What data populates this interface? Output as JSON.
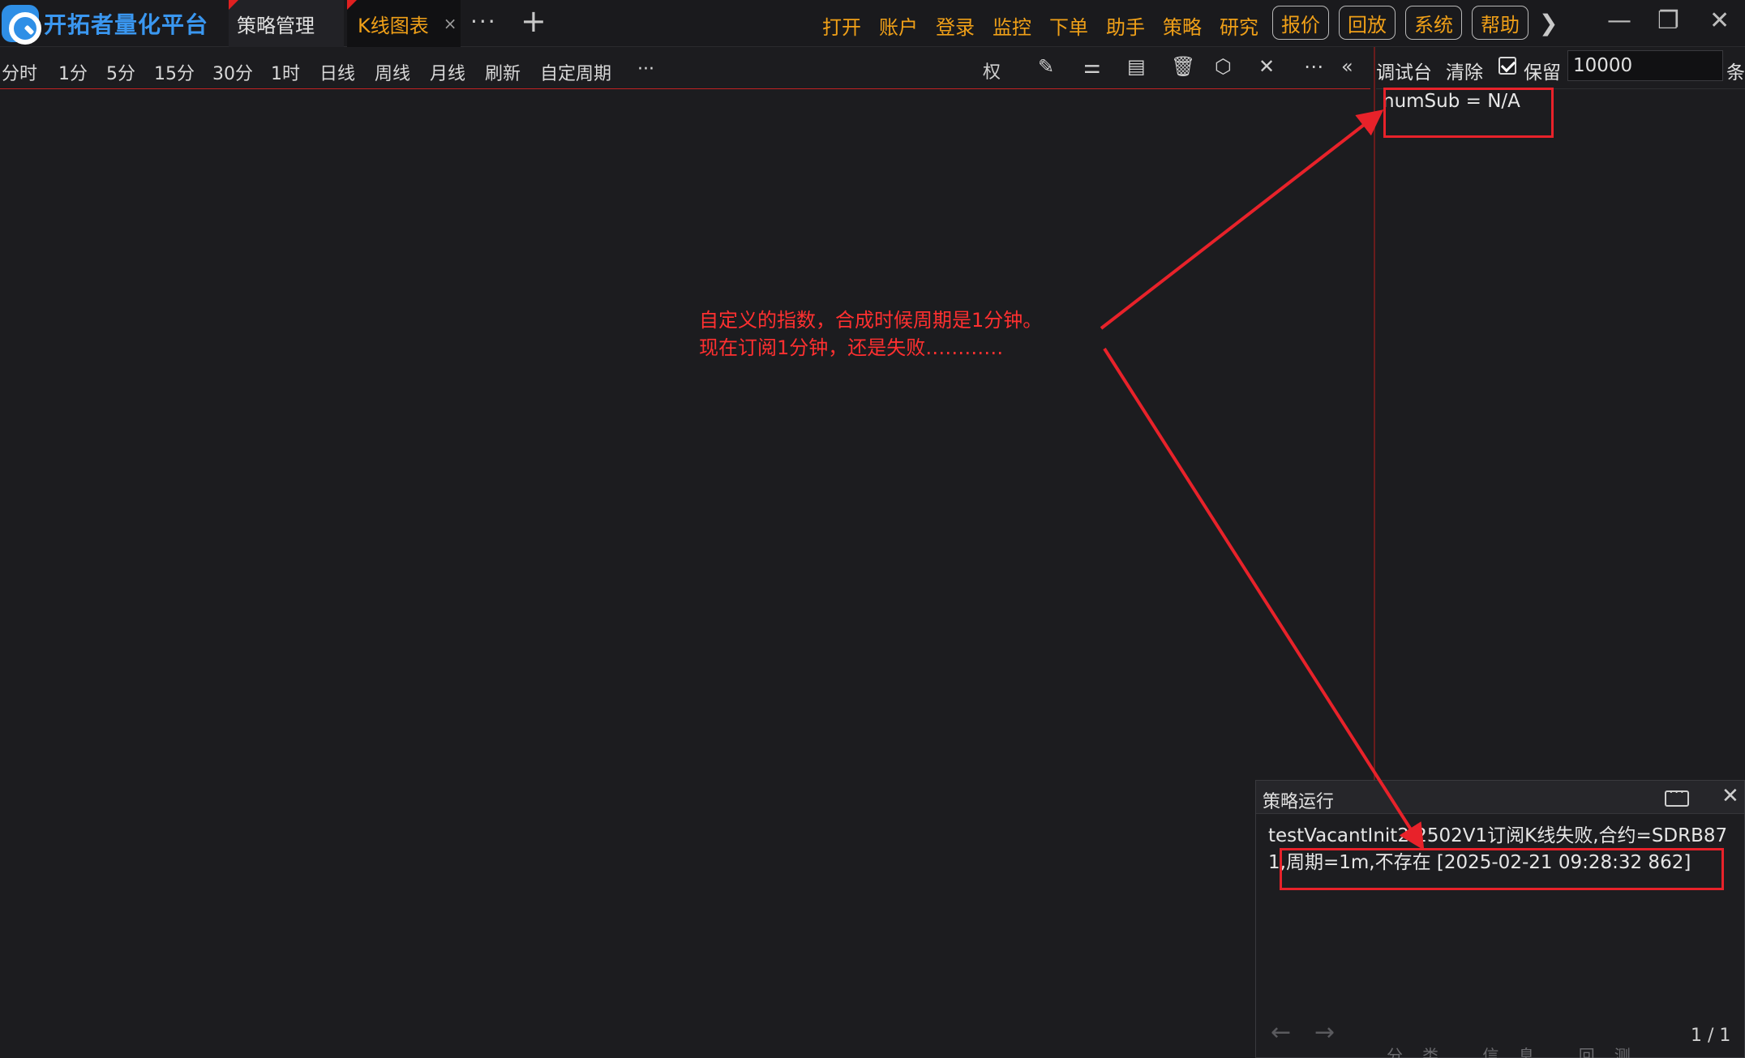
{
  "app": {
    "name": "开拓者量化平台"
  },
  "tabs": [
    {
      "label": "策略管理"
    },
    {
      "label": "K线图表",
      "close": "×"
    }
  ],
  "titlebar": {
    "more": "···",
    "add": "+"
  },
  "menu": {
    "items": [
      "打开",
      "账户",
      "登录",
      "监控",
      "下单",
      "助手",
      "策略",
      "研究"
    ],
    "buttons": [
      "报价",
      "回放",
      "系统",
      "帮助"
    ]
  },
  "periods": [
    "分时",
    "1分",
    "5分",
    "15分",
    "30分",
    "1时",
    "日线",
    "周线",
    "月线",
    "刷新",
    "自定周期",
    "···"
  ],
  "toolbar": {
    "rights_label": "权"
  },
  "console": {
    "title": "调试台",
    "clear": "清除",
    "keep": "保留",
    "keep_checked": true,
    "keep_value": "10000",
    "unit": "条",
    "output": "numSub = N/A"
  },
  "run_panel": {
    "title": "策略运行",
    "message": "testVacantInit2 2502V1订阅K线失败,合约=SDRB871,周期=1m,不存在 [2025-02-21 09:28:32 862]",
    "page": "1 / 1"
  },
  "bottom_tabs": "分类 信息 回测",
  "annotation": {
    "line1": "自定义的指数，合成时候周期是1分钟。",
    "line2": "现在订阅1分钟，还是失败…………"
  },
  "colors": {
    "accent": "#f0a018",
    "brand": "#3a97f0",
    "annotation": "#e8222a",
    "background": "#1c1c1f"
  }
}
